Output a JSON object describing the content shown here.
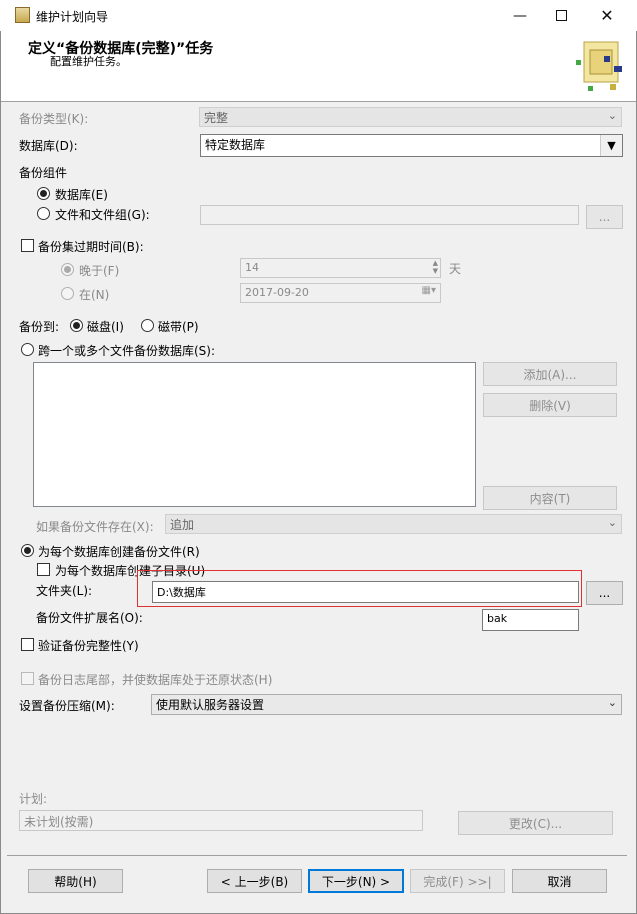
{
  "window": {
    "title": "维护计划向导"
  },
  "header": {
    "title": "定义“备份数据库(完整)”任务",
    "subtitle": "配置维护任务。"
  },
  "backup_type": {
    "label": "备份类型(K):",
    "value": "完整"
  },
  "database": {
    "label": "数据库(D):",
    "value": "特定数据库"
  },
  "component": {
    "label": "备份组件",
    "option_database": "数据库(E)",
    "option_files": "文件和文件组(G):",
    "ellipsis": "..."
  },
  "expire": {
    "label": "备份集过期时间(B):",
    "after_label": "晚于(F)",
    "after_value": "14",
    "unit": "天",
    "on_label": "在(N)",
    "on_value": "2017-09-20"
  },
  "backup_to": {
    "label": "备份到:",
    "disk": "磁盘(I)",
    "tape": "磁带(P)"
  },
  "span": {
    "label": "跨一个或多个文件备份数据库(S):",
    "add": "添加(A)...",
    "remove": "删除(V)",
    "contents": "内容(T)"
  },
  "if_exists": {
    "label": "如果备份文件存在(X):",
    "value": "追加"
  },
  "per_db": {
    "label": "为每个数据库创建备份文件(R)",
    "subdir": "为每个数据库创建子目录(U)",
    "folder_label": "文件夹(L):",
    "folder_value": "D:\\数据库",
    "folder_btn": "...",
    "ext_label": "备份文件扩展名(O):",
    "ext_value": "bak"
  },
  "verify": {
    "label": "验证备份完整性(Y)"
  },
  "tail_log": {
    "label": "备份日志尾部，并使数据库处于还原状态(H)"
  },
  "compression": {
    "label": "设置备份压缩(M):",
    "value": "使用默认服务器设置"
  },
  "schedule": {
    "label": "计划:",
    "value": "未计划(按需)",
    "change": "更改(C)..."
  },
  "buttons": {
    "help": "帮助(H)",
    "back": "< 上一步(B)",
    "next": "下一步(N) >",
    "finish": "完成(F) >>|",
    "cancel": "取消"
  },
  "accent_color": "#0078d7",
  "highlight_color": "#e03030"
}
